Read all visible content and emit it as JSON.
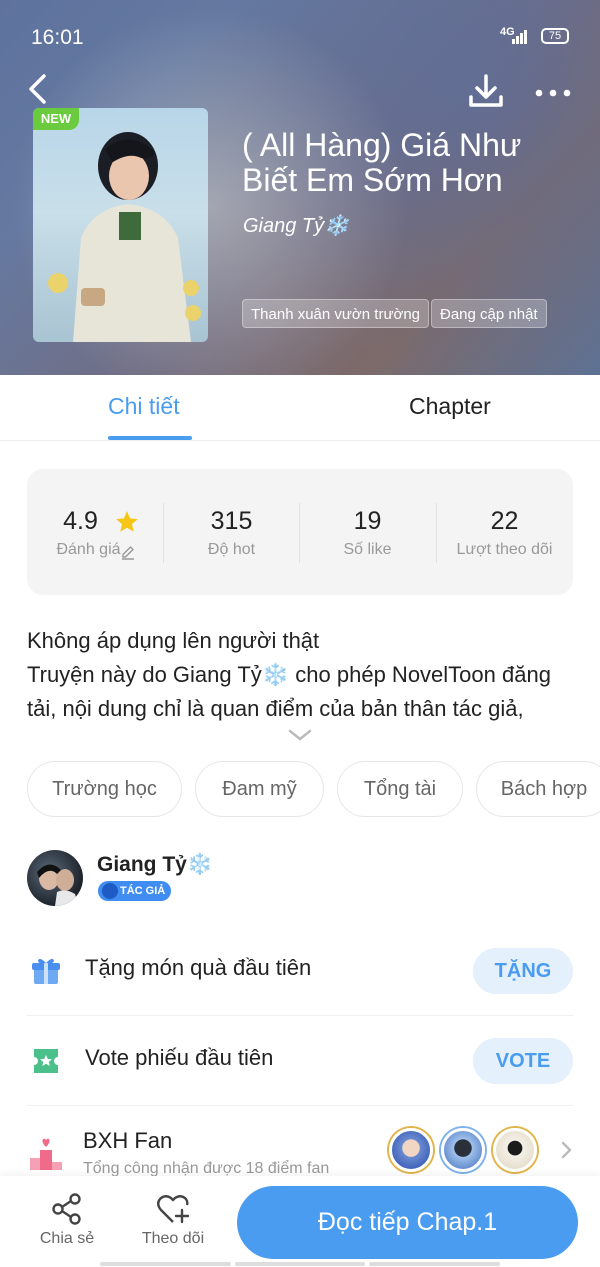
{
  "status_bar": {
    "time": "16:01",
    "network": "4G",
    "battery": "75"
  },
  "book": {
    "badge": "NEW",
    "title": "( All Hàng) Giá Như Biết Em Sớm Hơn",
    "author": "Giang Tỷ❄️",
    "tags": [
      "Thanh xuân vườn trường",
      "Đang cập nhật"
    ]
  },
  "tabs": [
    {
      "label": "Chi tiết",
      "active": true
    },
    {
      "label": "Chapter",
      "active": false
    }
  ],
  "stats": [
    {
      "value": "4.9",
      "label": "Đánh giá"
    },
    {
      "value": "315",
      "label": "Độ hot"
    },
    {
      "value": "19",
      "label": "Số like"
    },
    {
      "value": "22",
      "label": "Lượt theo dõi"
    }
  ],
  "description": {
    "line1": "Không áp dụng lên người thật",
    "line2": "Truyện này do Giang Tỷ❄️ cho phép NovelToon đăng tải, nội dung chỉ là quan điểm của bản thân tác giả,"
  },
  "genres": [
    "Trường học",
    "Đam mỹ",
    "Tổng tài",
    "Bách hợp"
  ],
  "author_block": {
    "name": "Giang Tỷ❄️",
    "badge": "TÁC GIẢ"
  },
  "actions": {
    "gift": {
      "label": "Tặng món quà đầu tiên",
      "button": "TẶNG"
    },
    "vote": {
      "label": "Vote phiếu đầu tiên",
      "button": "VOTE"
    }
  },
  "fan_rank": {
    "title": "BXH Fan",
    "subtitle": "Tổng công nhận được 18 điểm fan"
  },
  "bottom_bar": {
    "share": "Chia sẻ",
    "follow": "Theo dõi",
    "read": "Đọc tiếp Chap.1"
  },
  "colors": {
    "accent": "#4a9cf0",
    "new_badge": "#6acb3f",
    "star": "#f5c518"
  },
  "icons": [
    "back-icon",
    "download-icon",
    "more-icon",
    "star-icon",
    "edit-icon",
    "gift-icon",
    "ticket-icon",
    "podium-icon",
    "share-icon",
    "heart-plus-icon",
    "chevron-right-icon",
    "chevron-down-icon"
  ]
}
